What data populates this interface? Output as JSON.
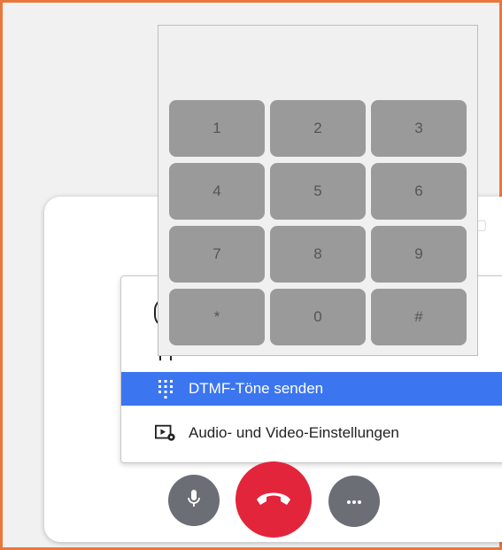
{
  "dialpad": {
    "keys": [
      "1",
      "2",
      "3",
      "4",
      "5",
      "6",
      "7",
      "8",
      "9",
      "*",
      "0",
      "#"
    ]
  },
  "menu": {
    "items": [
      {
        "label": "DTMF-Töne senden",
        "icon": "dialpad-icon",
        "active": true
      },
      {
        "label": "Audio- und Video-Einstellungen",
        "icon": "av-settings-icon",
        "active": false
      }
    ]
  },
  "controls": {
    "mic_icon": "microphone-icon",
    "hangup_icon": "hang-up-icon",
    "more_icon": "more-icon"
  },
  "colors": {
    "accent_blue": "#3b76f0",
    "hangup_red": "#e3253b",
    "control_gray": "#6b6e75",
    "key_gray": "#9a9a9a",
    "frame_orange": "#e9763a"
  }
}
